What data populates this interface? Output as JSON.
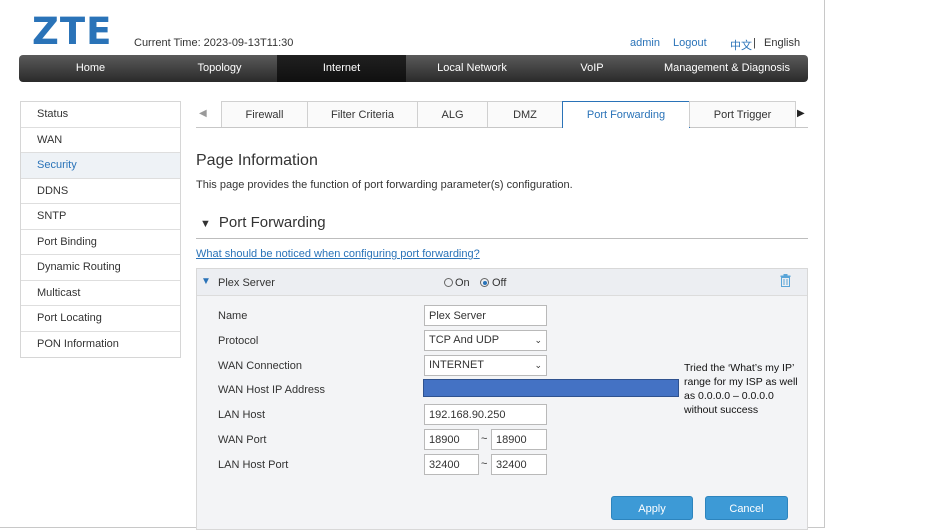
{
  "header": {
    "logo": "ZTE",
    "current_time": "Current Time: 2023-09-13T11:30",
    "user": "admin",
    "logout": "Logout",
    "lang_cn": "中文",
    "lang_sep": "|",
    "lang_en": "English"
  },
  "nav": {
    "items": [
      {
        "label": "Home"
      },
      {
        "label": "Topology"
      },
      {
        "label": "Internet"
      },
      {
        "label": "Local Network"
      },
      {
        "label": "VoIP"
      },
      {
        "label": "Management & Diagnosis"
      }
    ],
    "active": "Internet"
  },
  "sidebar": {
    "items": [
      {
        "label": "Status"
      },
      {
        "label": "WAN"
      },
      {
        "label": "Security"
      },
      {
        "label": "DDNS"
      },
      {
        "label": "SNTP"
      },
      {
        "label": "Port Binding"
      },
      {
        "label": "Dynamic Routing"
      },
      {
        "label": "Multicast"
      },
      {
        "label": "Port Locating"
      },
      {
        "label": "PON Information"
      }
    ],
    "active": "Security"
  },
  "tabs": {
    "prev_icon": "triangle-left",
    "next_icon": "triangle-right",
    "items": [
      {
        "label": "Firewall"
      },
      {
        "label": "Filter Criteria"
      },
      {
        "label": "ALG"
      },
      {
        "label": "DMZ"
      },
      {
        "label": "Port Forwarding"
      },
      {
        "label": "Port Trigger"
      }
    ],
    "active": "Port Forwarding"
  },
  "page": {
    "title": "Page Information",
    "description": "This page provides the function of port forwarding parameter(s) configuration.",
    "section_title": "Port Forwarding",
    "notice_link": "What should be noticed when configuring port forwarding?"
  },
  "rule": {
    "name_header": "Plex Server",
    "on_label": "On",
    "off_label": "Off",
    "state": "Off",
    "fields": {
      "name_label": "Name",
      "name_value": "Plex Server",
      "protocol_label": "Protocol",
      "protocol_value": "TCP And UDP",
      "wan_connection_label": "WAN Connection",
      "wan_connection_value": "INTERNET",
      "wan_host_ip_label": "WAN Host IP Address",
      "lan_host_label": "LAN Host",
      "lan_host_value": "192.168.90.250",
      "wan_port_label": "WAN Port",
      "wan_port_start": "18900",
      "wan_port_end": "18900",
      "lan_host_port_label": "LAN Host Port",
      "lan_host_port_start": "32400",
      "lan_host_port_end": "32400",
      "range_sep": "~"
    },
    "apply_label": "Apply",
    "cancel_label": "Cancel"
  },
  "annotation": "Tried the ‘What’s my IP’ range for my ISP as well as 0.0.0.0 – 0.0.0.0 without  success",
  "colors": {
    "brand": "#2a73b8",
    "button": "#3d9ad6",
    "redaction": "#4472c4"
  }
}
